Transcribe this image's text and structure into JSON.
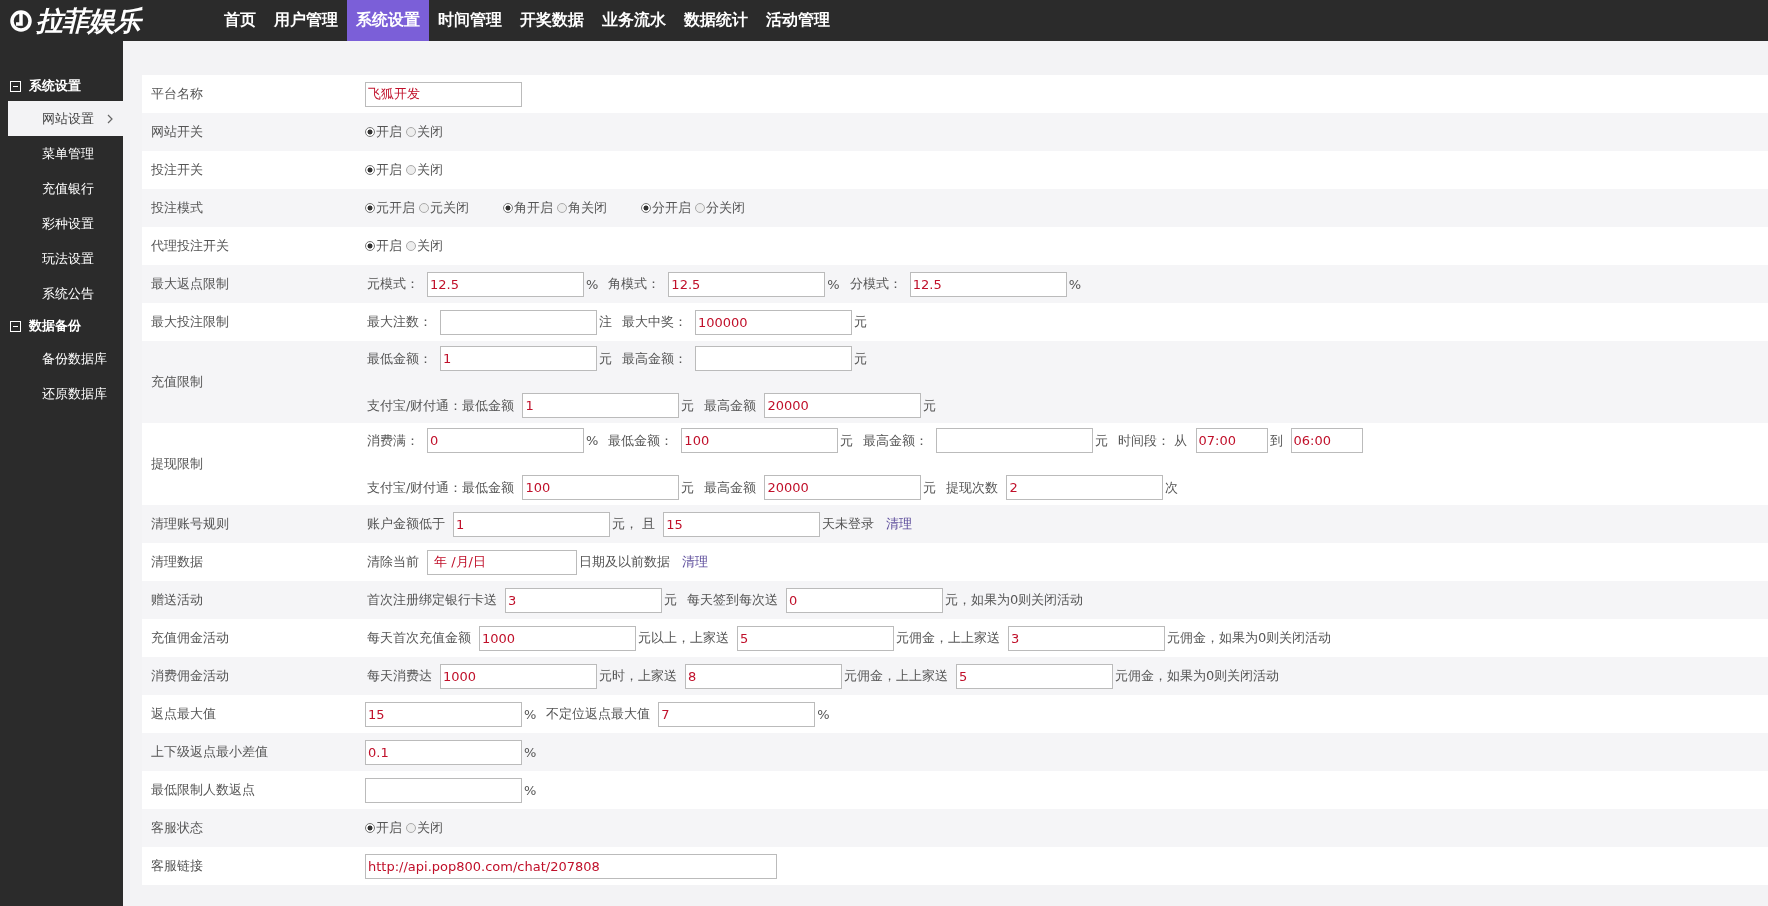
{
  "logo": {
    "text": "拉菲娱乐"
  },
  "nav": [
    {
      "label": "首页",
      "selected": false
    },
    {
      "label": "用户管理",
      "selected": false
    },
    {
      "label": "系统设置",
      "selected": true
    },
    {
      "label": "时间管理",
      "selected": false
    },
    {
      "label": "开奖数据",
      "selected": false
    },
    {
      "label": "业务流水",
      "selected": false
    },
    {
      "label": "数据统计",
      "selected": false
    },
    {
      "label": "活动管理",
      "selected": false
    }
  ],
  "sidebar": [
    {
      "label": "系统设置",
      "expanded": true,
      "children": [
        {
          "label": "网站设置",
          "selected": true
        },
        {
          "label": "菜单管理",
          "selected": false
        },
        {
          "label": "充值银行",
          "selected": false
        },
        {
          "label": "彩种设置",
          "selected": false
        },
        {
          "label": "玩法设置",
          "selected": false
        },
        {
          "label": "系统公告",
          "selected": false
        }
      ]
    },
    {
      "label": "数据备份",
      "expanded": true,
      "children": [
        {
          "label": "备份数据库",
          "selected": false
        },
        {
          "label": "还原数据库",
          "selected": false
        }
      ]
    }
  ],
  "form": [
    {
      "label": "平台名称",
      "lines": [
        [
          {
            "kind": "input",
            "value": "飞狐开发"
          }
        ]
      ]
    },
    {
      "label": "网站开关",
      "lines": [
        [
          {
            "kind": "radios",
            "options": [
              {
                "label": "开启",
                "selected": true
              },
              {
                "label": "关闭",
                "selected": false
              }
            ]
          }
        ]
      ]
    },
    {
      "label": "投注开关",
      "lines": [
        [
          {
            "kind": "radios",
            "options": [
              {
                "label": "开启",
                "selected": true
              },
              {
                "label": "关闭",
                "selected": false
              }
            ]
          }
        ]
      ]
    },
    {
      "label": "投注模式",
      "lines": [
        [
          {
            "kind": "radios",
            "options": [
              {
                "label": "元开启",
                "selected": true
              },
              {
                "label": "元关闭",
                "selected": false
              }
            ]
          },
          {
            "kind": "radios",
            "options": [
              {
                "label": "角开启",
                "selected": true
              },
              {
                "label": "角关闭",
                "selected": false
              }
            ]
          },
          {
            "kind": "radios",
            "options": [
              {
                "label": "分开启",
                "selected": true
              },
              {
                "label": "分关闭",
                "selected": false
              }
            ]
          }
        ]
      ]
    },
    {
      "label": "代理投注开关",
      "lines": [
        [
          {
            "kind": "radios",
            "options": [
              {
                "label": "开启",
                "selected": true
              },
              {
                "label": "关闭",
                "selected": false
              }
            ]
          }
        ]
      ]
    },
    {
      "label": "最大返点限制",
      "lines": [
        [
          {
            "kind": "text",
            "text": "元模式："
          },
          {
            "kind": "input",
            "value": "12.5"
          },
          {
            "kind": "text",
            "text": "%"
          },
          {
            "kind": "text",
            "text": "角模式："
          },
          {
            "kind": "input",
            "value": "12.5"
          },
          {
            "kind": "text",
            "text": "%"
          },
          {
            "kind": "text",
            "text": "分模式："
          },
          {
            "kind": "input",
            "value": "12.5"
          },
          {
            "kind": "text",
            "text": "%"
          }
        ]
      ]
    },
    {
      "label": "最大投注限制",
      "lines": [
        [
          {
            "kind": "text",
            "text": "最大注数："
          },
          {
            "kind": "input"
          },
          {
            "kind": "text",
            "text": "注"
          },
          {
            "kind": "text",
            "text": "最大中奖："
          },
          {
            "kind": "input",
            "value": "100000"
          },
          {
            "kind": "text",
            "text": "元"
          }
        ]
      ]
    },
    {
      "label": "充值限制",
      "lines": [
        [
          {
            "kind": "text",
            "text": "最低金额："
          },
          {
            "kind": "input",
            "value": "1"
          },
          {
            "kind": "text",
            "text": "元"
          },
          {
            "kind": "text",
            "text": "最高金额："
          },
          {
            "kind": "input"
          },
          {
            "kind": "text",
            "text": "元"
          }
        ],
        [
          {
            "kind": "text",
            "text": "支付宝/财付通：最低金额"
          },
          {
            "kind": "input",
            "value": "1"
          },
          {
            "kind": "text",
            "text": "元"
          },
          {
            "kind": "text",
            "text": "最高金额"
          },
          {
            "kind": "input",
            "value": "20000"
          },
          {
            "kind": "text",
            "text": "元"
          }
        ]
      ]
    },
    {
      "label": "提现限制",
      "lines": [
        [
          {
            "kind": "text",
            "text": "消费满："
          },
          {
            "kind": "input",
            "value": "0"
          },
          {
            "kind": "text",
            "text": "%"
          },
          {
            "kind": "text",
            "text": "最低金额："
          },
          {
            "kind": "input",
            "value": "100"
          },
          {
            "kind": "text",
            "text": "元"
          },
          {
            "kind": "text",
            "text": "最高金额："
          },
          {
            "kind": "input"
          },
          {
            "kind": "text",
            "text": "元"
          },
          {
            "kind": "text",
            "text": "时间段： 从"
          },
          {
            "kind": "time",
            "value": "07:00"
          },
          {
            "kind": "text",
            "text": "到"
          },
          {
            "kind": "time",
            "value": "06:00"
          }
        ],
        [
          {
            "kind": "text",
            "text": "支付宝/财付通：最低金额"
          },
          {
            "kind": "input",
            "value": "100"
          },
          {
            "kind": "text",
            "text": "元"
          },
          {
            "kind": "text",
            "text": "最高金额"
          },
          {
            "kind": "input",
            "value": "20000"
          },
          {
            "kind": "text",
            "text": "元"
          },
          {
            "kind": "text",
            "text": "提现次数"
          },
          {
            "kind": "input",
            "value": "2"
          },
          {
            "kind": "text",
            "text": "次"
          }
        ]
      ]
    },
    {
      "label": "清理账号规则",
      "lines": [
        [
          {
            "kind": "text",
            "text": "账户金额低于"
          },
          {
            "kind": "input",
            "value": "1"
          },
          {
            "kind": "text",
            "text": "元， 且"
          },
          {
            "kind": "input",
            "value": "15"
          },
          {
            "kind": "text",
            "text": "天未登录"
          },
          {
            "kind": "link",
            "text": "清理"
          }
        ]
      ]
    },
    {
      "label": "清理数据",
      "lines": [
        [
          {
            "kind": "text",
            "text": "清除当前"
          },
          {
            "kind": "date",
            "value": "年 /月/日"
          },
          {
            "kind": "text",
            "text": "日期及以前数据"
          },
          {
            "kind": "link",
            "text": "清理"
          }
        ]
      ]
    },
    {
      "label": "赠送活动",
      "lines": [
        [
          {
            "kind": "text",
            "text": "首次注册绑定银行卡送"
          },
          {
            "kind": "input",
            "value": "3"
          },
          {
            "kind": "text",
            "text": "元"
          },
          {
            "kind": "text",
            "text": "每天签到每次送"
          },
          {
            "kind": "input",
            "value": "0"
          },
          {
            "kind": "text",
            "text": "元，如果为0则关闭活动"
          }
        ]
      ]
    },
    {
      "label": "充值佣金活动",
      "lines": [
        [
          {
            "kind": "text",
            "text": "每天首次充值金额"
          },
          {
            "kind": "input",
            "value": "1000"
          },
          {
            "kind": "text",
            "text": "元以上，上家送"
          },
          {
            "kind": "input",
            "value": "5"
          },
          {
            "kind": "text",
            "text": "元佣金，上上家送"
          },
          {
            "kind": "input",
            "value": "3"
          },
          {
            "kind": "text",
            "text": "元佣金，如果为0则关闭活动"
          }
        ]
      ]
    },
    {
      "label": "消费佣金活动",
      "lines": [
        [
          {
            "kind": "text",
            "text": "每天消费达"
          },
          {
            "kind": "input",
            "value": "1000"
          },
          {
            "kind": "text",
            "text": "元时，上家送"
          },
          {
            "kind": "input",
            "value": "8"
          },
          {
            "kind": "text",
            "text": "元佣金，上上家送"
          },
          {
            "kind": "input",
            "value": "5"
          },
          {
            "kind": "text",
            "text": "元佣金，如果为0则关闭活动"
          }
        ]
      ]
    },
    {
      "label": "返点最大值",
      "lines": [
        [
          {
            "kind": "input",
            "value": "15"
          },
          {
            "kind": "text",
            "text": "%"
          },
          {
            "kind": "text",
            "text": "不定位返点最大值"
          },
          {
            "kind": "input",
            "value": "7"
          },
          {
            "kind": "text",
            "text": "%"
          }
        ]
      ]
    },
    {
      "label": "上下级返点最小差值",
      "lines": [
        [
          {
            "kind": "input",
            "value": "0.1"
          },
          {
            "kind": "text",
            "text": "%"
          }
        ]
      ]
    },
    {
      "label": "最低限制人数返点",
      "lines": [
        [
          {
            "kind": "input"
          },
          {
            "kind": "text",
            "text": "%"
          }
        ]
      ]
    },
    {
      "label": "客服状态",
      "lines": [
        [
          {
            "kind": "radios",
            "options": [
              {
                "label": "开启",
                "selected": true
              },
              {
                "label": "关闭",
                "selected": false
              }
            ]
          }
        ]
      ]
    },
    {
      "label": "客服链接",
      "lines": [
        [
          {
            "kind": "url",
            "value": "http://api.pop800.com/chat/207808"
          }
        ]
      ]
    }
  ]
}
